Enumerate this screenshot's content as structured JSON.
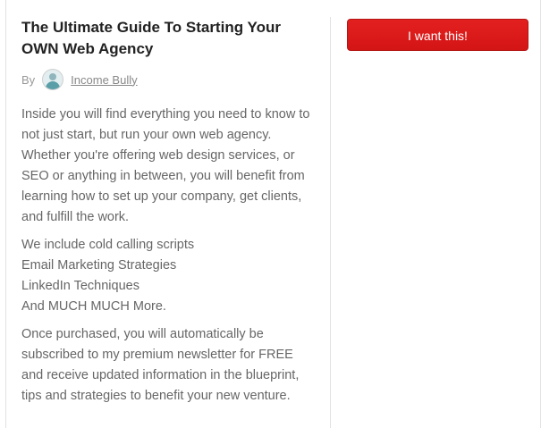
{
  "product": {
    "title_line1": "The Ultimate Guide To Starting Your",
    "title_line2": "OWN Web Agency"
  },
  "author": {
    "by_label": "By",
    "name": "Income Bully"
  },
  "description": {
    "paragraph1": "Inside you will find everything you need to know to not just start, but run your own web agency. Whether you're offering web design services, or SEO or anything in between, you will benefit from learning how to set up your company, get clients, and fulfill the work.",
    "list_lines": [
      "We include cold calling scripts",
      "Email Marketing Strategies",
      "LinkedIn Techniques",
      "And MUCH MUCH More."
    ],
    "paragraph3": "Once purchased, you will automatically be subscribed to my premium newsletter for FREE and receive updated information in the blueprint, tips and strategies to benefit your new venture."
  },
  "cta": {
    "label": "I want this!"
  }
}
